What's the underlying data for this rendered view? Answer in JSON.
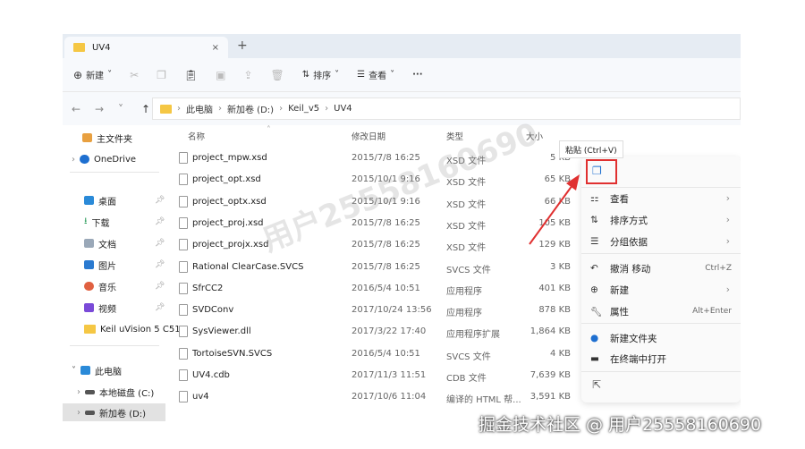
{
  "tab": {
    "title": "UV4",
    "close": "×",
    "new": "+"
  },
  "toolbar": {
    "new": "新建",
    "sort": "排序",
    "view": "查看",
    "more": "···"
  },
  "breadcrumb": [
    "此电脑",
    "新加卷 (D:)",
    "Keil_v5",
    "UV4"
  ],
  "sidebar": {
    "items": [
      "主文件夹",
      "OneDrive",
      "桌面",
      "下载",
      "文档",
      "图片",
      "音乐",
      "视频",
      "Keil uVision 5 C51",
      "此电脑",
      "本地磁盘 (C:)",
      "新加卷 (D:)"
    ]
  },
  "columns": {
    "name": "名称",
    "date": "修改日期",
    "type": "类型",
    "size": "大小"
  },
  "files": [
    {
      "name": "project_mpw.xsd",
      "date": "2015/7/8 16:25",
      "type": "XSD 文件",
      "size": "5 KB"
    },
    {
      "name": "project_opt.xsd",
      "date": "2015/10/1 9:16",
      "type": "XSD 文件",
      "size": "65 KB"
    },
    {
      "name": "project_optx.xsd",
      "date": "2015/10/1 9:16",
      "type": "XSD 文件",
      "size": "66 KB"
    },
    {
      "name": "project_proj.xsd",
      "date": "2015/7/8 16:25",
      "type": "XSD 文件",
      "size": "105 KB"
    },
    {
      "name": "project_projx.xsd",
      "date": "2015/7/8 16:25",
      "type": "XSD 文件",
      "size": "129 KB"
    },
    {
      "name": "Rational ClearCase.SVCS",
      "date": "2015/7/8 16:25",
      "type": "SVCS 文件",
      "size": "3 KB"
    },
    {
      "name": "SfrCC2",
      "date": "2016/5/4 10:51",
      "type": "应用程序",
      "size": "401 KB"
    },
    {
      "name": "SVDConv",
      "date": "2017/10/24 13:56",
      "type": "应用程序",
      "size": "878 KB"
    },
    {
      "name": "SysViewer.dll",
      "date": "2017/3/22 17:40",
      "type": "应用程序扩展",
      "size": "1,864 KB"
    },
    {
      "name": "TortoiseSVN.SVCS",
      "date": "2016/5/4 10:51",
      "type": "SVCS 文件",
      "size": "4 KB"
    },
    {
      "name": "UV4.cdb",
      "date": "2017/11/3 11:51",
      "type": "CDB 文件",
      "size": "7,639 KB"
    },
    {
      "name": "uv4",
      "date": "2017/10/6 11:04",
      "type": "编译的 HTML 帮...",
      "size": "3,591 KB"
    }
  ],
  "context_menu": {
    "tooltip": "粘贴 (Ctrl+V)",
    "items": [
      {
        "label": "查看",
        "submenu": true
      },
      {
        "label": "排序方式",
        "submenu": true
      },
      {
        "label": "分组依据",
        "submenu": true
      },
      {
        "label": "撤消 移动",
        "shortcut": "Ctrl+Z"
      },
      {
        "label": "新建",
        "submenu": true
      },
      {
        "label": "属性",
        "shortcut": "Alt+Enter"
      },
      {
        "label": "新建文件夹"
      },
      {
        "label": "在终端中打开"
      }
    ]
  },
  "watermark": "用户25558160690",
  "footer": "掘金技术社区 @ 用户25558160690",
  "colors": {
    "highlight": "#e03030",
    "accent": "#1e6fd0"
  }
}
